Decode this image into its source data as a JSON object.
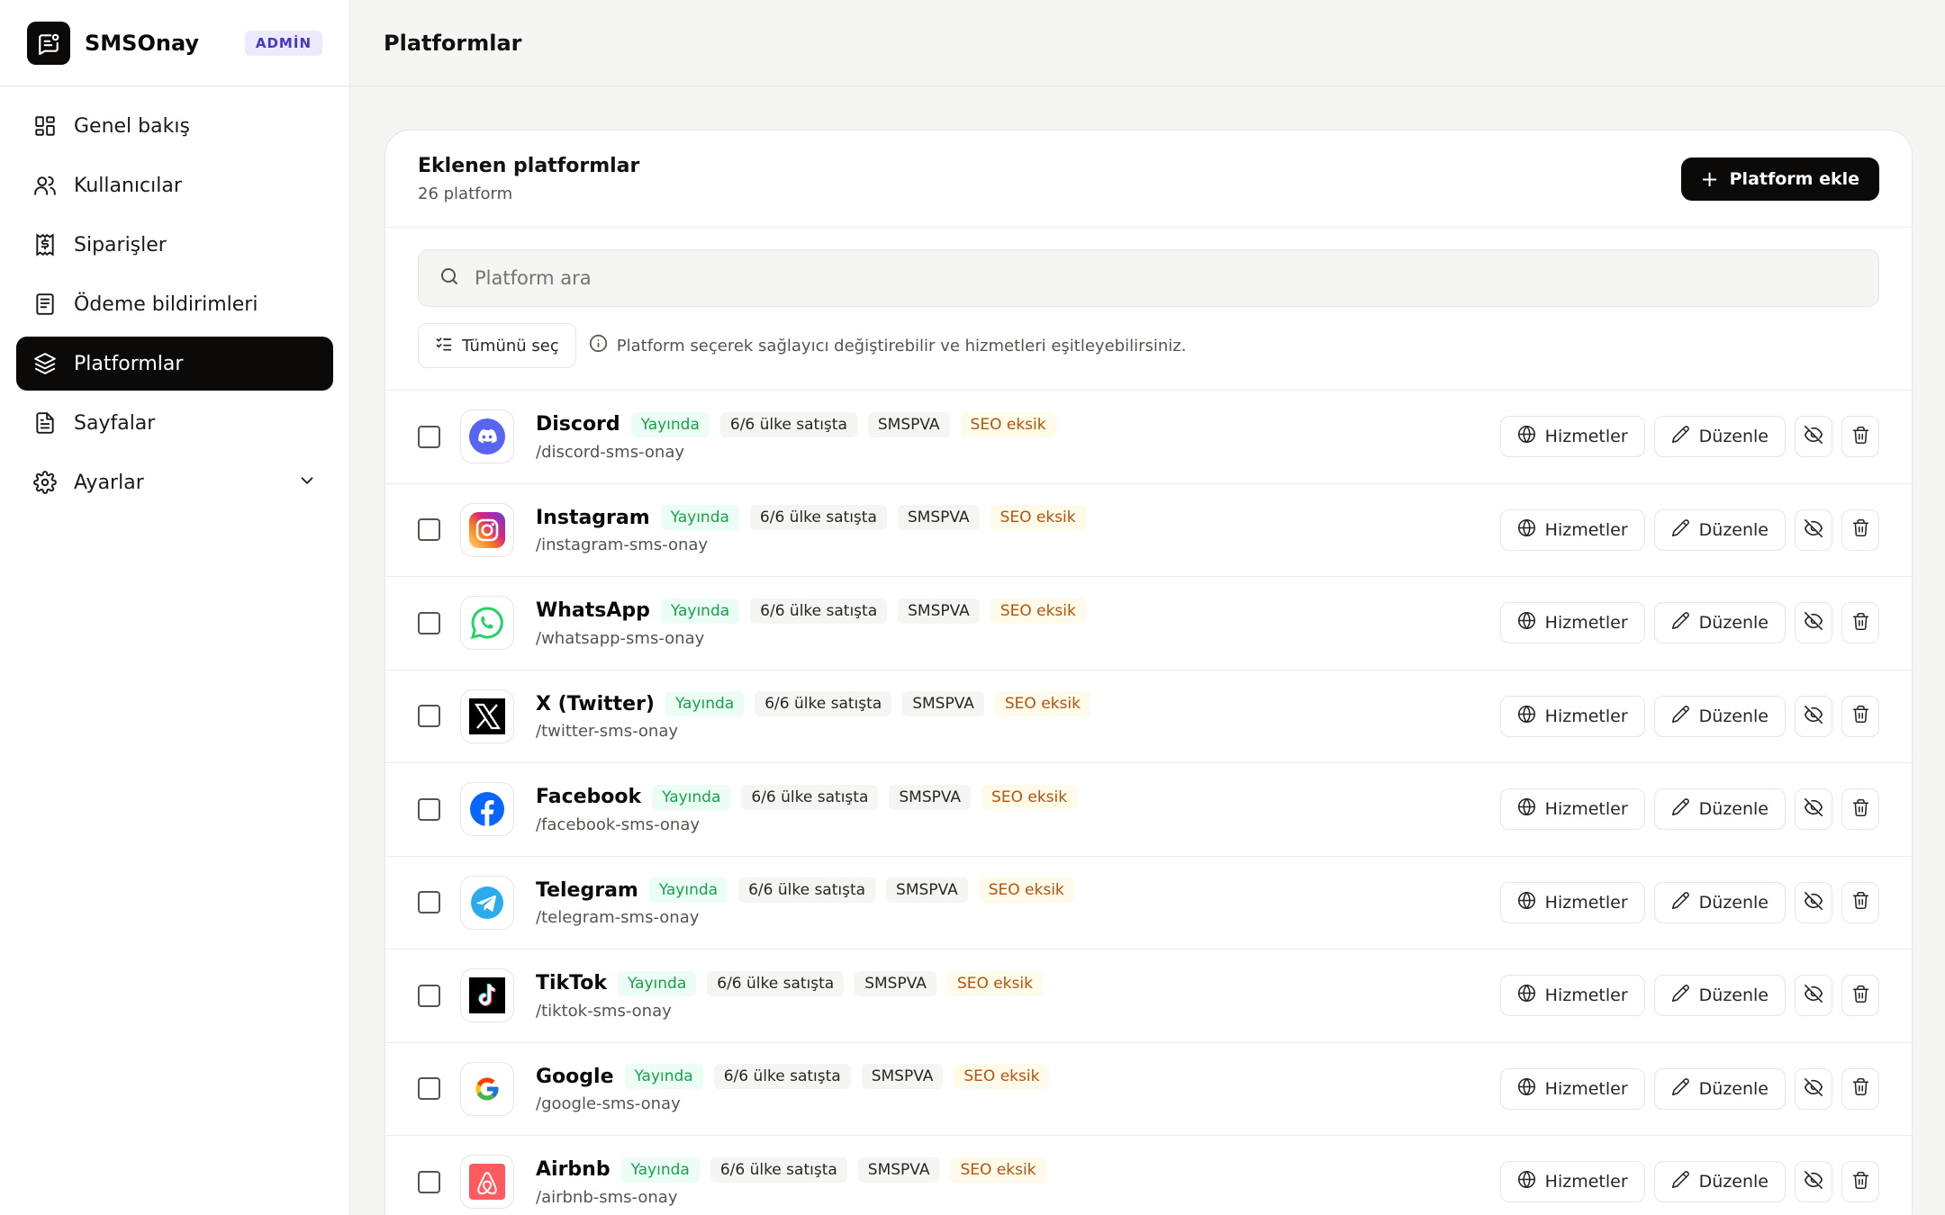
{
  "brand": {
    "name": "SMSOnay",
    "badge": "ADMİN"
  },
  "nav": {
    "items": [
      {
        "label": "Genel bakış",
        "icon": "grid-icon"
      },
      {
        "label": "Kullanıcılar",
        "icon": "users-icon"
      },
      {
        "label": "Siparişler",
        "icon": "receipt-dollar-icon"
      },
      {
        "label": "Ödeme bildirimleri",
        "icon": "list-doc-icon"
      },
      {
        "label": "Platformlar",
        "icon": "layers-icon",
        "active": true
      },
      {
        "label": "Sayfalar",
        "icon": "file-text-icon"
      },
      {
        "label": "Ayarlar",
        "icon": "gear-icon"
      }
    ]
  },
  "header": {
    "title": "Platformlar"
  },
  "card": {
    "title": "Eklenen platformlar",
    "subtitle": "26 platform",
    "add_label": "Platform ekle"
  },
  "search": {
    "placeholder": "Platform ara"
  },
  "tools": {
    "select_all": "Tümünü seç",
    "hint": "Platform seçerek sağlayıcı değiştirebilir ve hizmetleri eşitleyebilirsiniz."
  },
  "row_labels": {
    "services": "Hizmetler",
    "edit": "Düzenle"
  },
  "platforms": [
    {
      "name": "Discord",
      "slug": "/discord-sms-onay",
      "status": "Yayında",
      "countries": "6/6 ülke satışta",
      "provider": "SMSPVA",
      "seo": "SEO eksik",
      "icon": "discord-icon"
    },
    {
      "name": "Instagram",
      "slug": "/instagram-sms-onay",
      "status": "Yayında",
      "countries": "6/6 ülke satışta",
      "provider": "SMSPVA",
      "seo": "SEO eksik",
      "icon": "instagram-icon"
    },
    {
      "name": "WhatsApp",
      "slug": "/whatsapp-sms-onay",
      "status": "Yayında",
      "countries": "6/6 ülke satışta",
      "provider": "SMSPVA",
      "seo": "SEO eksik",
      "icon": "whatsapp-icon"
    },
    {
      "name": "X (Twitter)",
      "slug": "/twitter-sms-onay",
      "status": "Yayında",
      "countries": "6/6 ülke satışta",
      "provider": "SMSPVA",
      "seo": "SEO eksik",
      "icon": "x-icon"
    },
    {
      "name": "Facebook",
      "slug": "/facebook-sms-onay",
      "status": "Yayında",
      "countries": "6/6 ülke satışta",
      "provider": "SMSPVA",
      "seo": "SEO eksik",
      "icon": "facebook-icon"
    },
    {
      "name": "Telegram",
      "slug": "/telegram-sms-onay",
      "status": "Yayında",
      "countries": "6/6 ülke satışta",
      "provider": "SMSPVA",
      "seo": "SEO eksik",
      "icon": "telegram-icon"
    },
    {
      "name": "TikTok",
      "slug": "/tiktok-sms-onay",
      "status": "Yayında",
      "countries": "6/6 ülke satışta",
      "provider": "SMSPVA",
      "seo": "SEO eksik",
      "icon": "tiktok-icon"
    },
    {
      "name": "Google",
      "slug": "/google-sms-onay",
      "status": "Yayında",
      "countries": "6/6 ülke satışta",
      "provider": "SMSPVA",
      "seo": "SEO eksik",
      "icon": "google-icon"
    },
    {
      "name": "Airbnb",
      "slug": "/airbnb-sms-onay",
      "status": "Yayında",
      "countries": "6/6 ülke satışta",
      "provider": "SMSPVA",
      "seo": "SEO eksik",
      "icon": "airbnb-icon"
    }
  ],
  "colors": {
    "accent": "#0c0a09",
    "live": "#16a34a",
    "warn": "#b45309",
    "badge": "#4338ca"
  }
}
